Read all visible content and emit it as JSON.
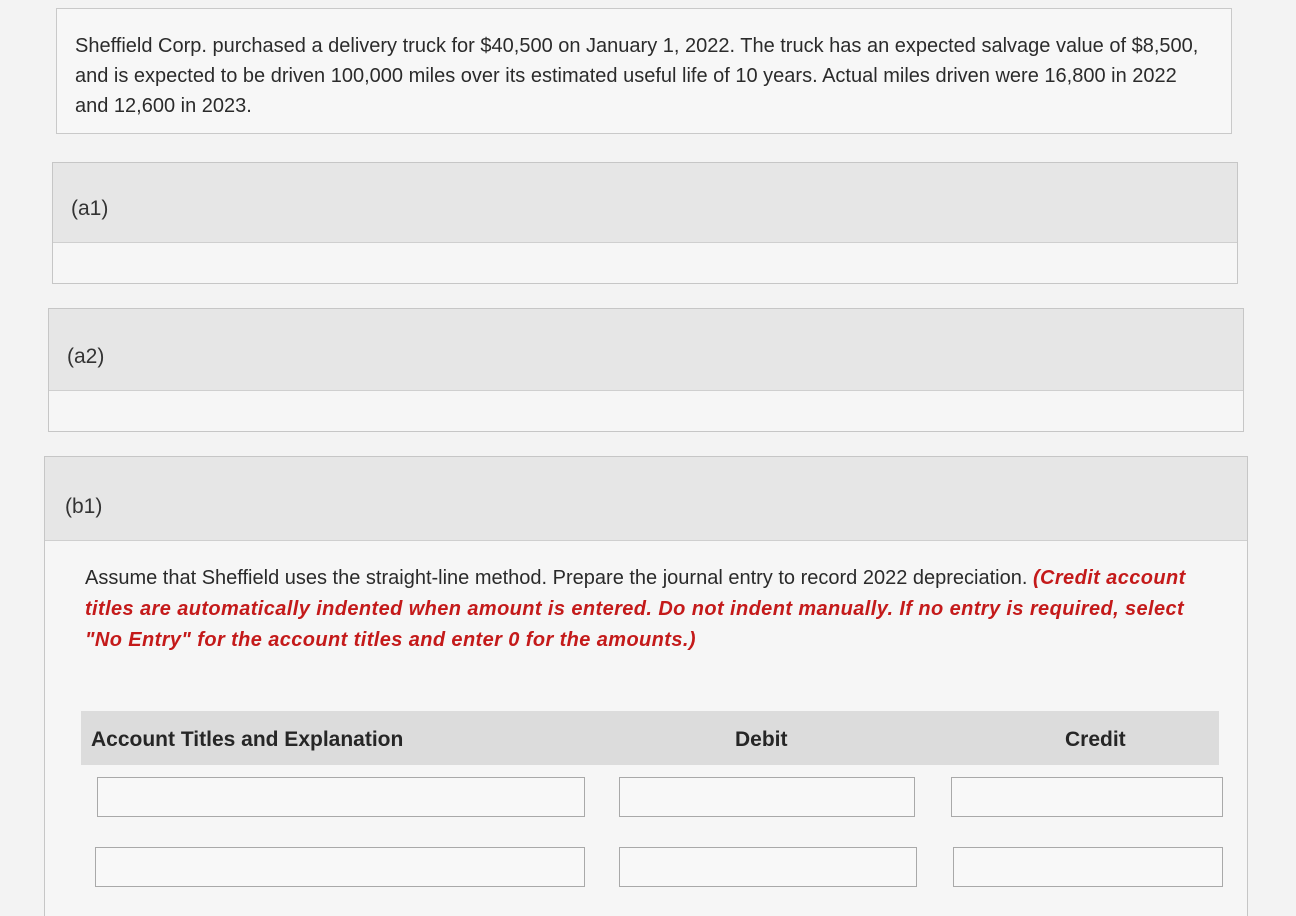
{
  "problem": {
    "text": "Sheffield Corp. purchased a delivery truck for $40,500 on January 1, 2022. The truck has an expected salvage value of $8,500, and is expected to be driven 100,000 miles over its estimated useful life of 10 years. Actual miles driven were 16,800 in 2022 and 12,600 in 2023."
  },
  "parts": {
    "a1": {
      "label": "(a1)"
    },
    "a2": {
      "label": "(a2)"
    },
    "b1": {
      "label": "(b1)",
      "instruction": "Assume that Sheffield uses the straight-line method. Prepare the journal entry to record 2022 depreciation.",
      "note": "(Credit account titles are automatically indented when amount is entered. Do not indent manually. If no entry is required, select \"No Entry\" for the account titles and enter 0 for the amounts.)"
    }
  },
  "journal": {
    "columns": {
      "account": "Account Titles and Explanation",
      "debit": "Debit",
      "credit": "Credit"
    },
    "rows": [
      {
        "account": "",
        "debit": "",
        "credit": ""
      },
      {
        "account": "",
        "debit": "",
        "credit": ""
      }
    ]
  }
}
